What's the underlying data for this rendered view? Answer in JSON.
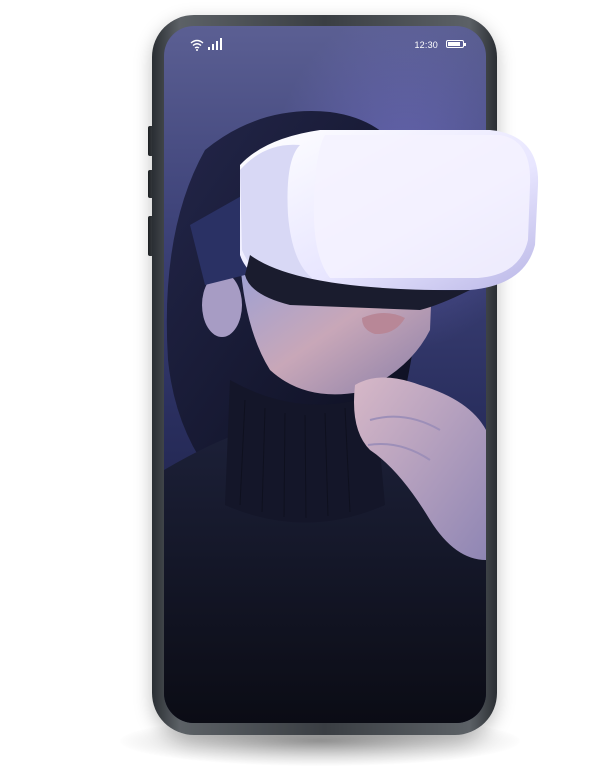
{
  "status_bar": {
    "time": "12:30",
    "wifi_icon": "wifi-icon",
    "signal_icon": "signal-bars-icon",
    "battery_icon": "battery-icon"
  },
  "photo": {
    "colors": {
      "background": "#2a2f5f",
      "headset": "#eef0ff",
      "sweater": "#11131f",
      "skin": "#c8a7b8"
    }
  }
}
